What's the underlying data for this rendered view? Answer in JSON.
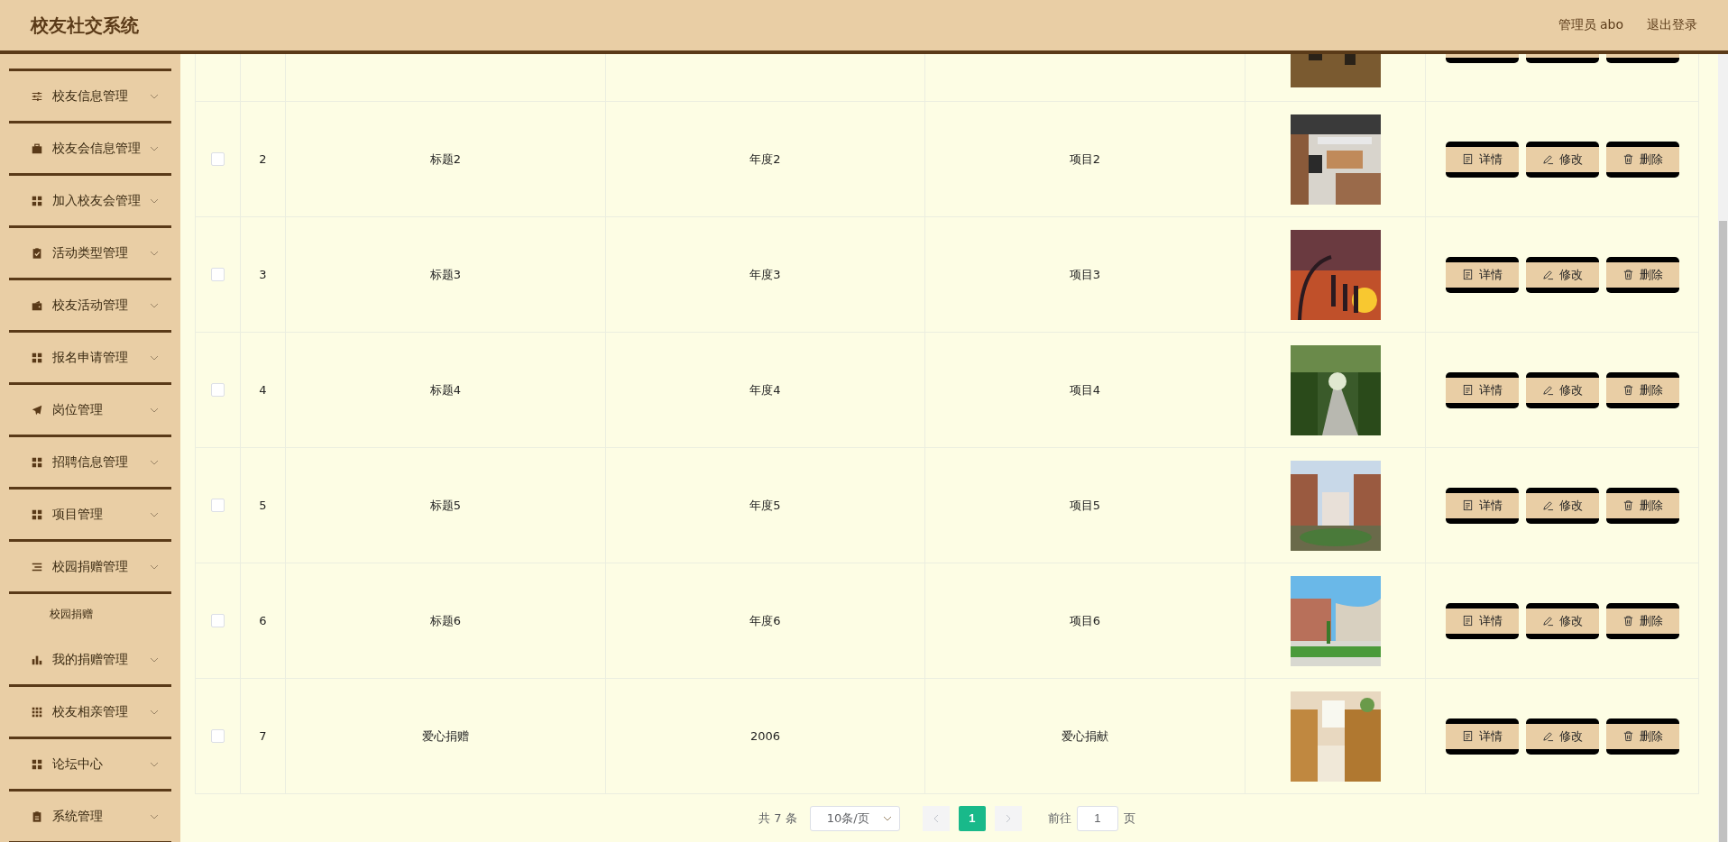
{
  "header": {
    "title": "校友社交系统",
    "user": "管理员 abo",
    "logout": "退出登录"
  },
  "sidebar": {
    "items": [
      {
        "label": "校友信息管理"
      },
      {
        "label": "校友会信息管理"
      },
      {
        "label": "加入校友会管理"
      },
      {
        "label": "活动类型管理"
      },
      {
        "label": "校友活动管理"
      },
      {
        "label": "报名申请管理"
      },
      {
        "label": "岗位管理"
      },
      {
        "label": "招聘信息管理"
      },
      {
        "label": "项目管理"
      },
      {
        "label": "校园捐赠管理",
        "children": [
          {
            "label": "校园捐赠"
          }
        ]
      },
      {
        "label": "我的捐赠管理"
      },
      {
        "label": "校友相亲管理"
      },
      {
        "label": "论坛中心"
      },
      {
        "label": "系统管理"
      }
    ]
  },
  "table": {
    "rows": [
      {
        "kind": "cut",
        "actions": [
          {
            "kind": "detail"
          },
          {
            "kind": "edit"
          },
          {
            "kind": "delete"
          }
        ]
      },
      {
        "kind": "full",
        "checked": false,
        "index": "2",
        "title": "标题2",
        "year": "年度2",
        "project": "项目2",
        "actions": [
          {
            "kind": "detail",
            "label": "详情"
          },
          {
            "kind": "edit",
            "label": "修改"
          },
          {
            "kind": "delete",
            "label": "删除"
          }
        ]
      },
      {
        "kind": "full",
        "checked": false,
        "index": "3",
        "title": "标题3",
        "year": "年度3",
        "project": "项目3",
        "actions": [
          {
            "kind": "detail",
            "label": "详情"
          },
          {
            "kind": "edit",
            "label": "修改"
          },
          {
            "kind": "delete",
            "label": "删除"
          }
        ]
      },
      {
        "kind": "full",
        "checked": false,
        "index": "4",
        "title": "标题4",
        "year": "年度4",
        "project": "项目4",
        "actions": [
          {
            "kind": "detail",
            "label": "详情"
          },
          {
            "kind": "edit",
            "label": "修改"
          },
          {
            "kind": "delete",
            "label": "删除"
          }
        ]
      },
      {
        "kind": "full",
        "checked": false,
        "index": "5",
        "title": "标题5",
        "year": "年度5",
        "project": "项目5",
        "actions": [
          {
            "kind": "detail",
            "label": "详情"
          },
          {
            "kind": "edit",
            "label": "修改"
          },
          {
            "kind": "delete",
            "label": "删除"
          }
        ]
      },
      {
        "kind": "full",
        "checked": false,
        "index": "6",
        "title": "标题6",
        "year": "年度6",
        "project": "项目6",
        "actions": [
          {
            "kind": "detail",
            "label": "详情"
          },
          {
            "kind": "edit",
            "label": "修改"
          },
          {
            "kind": "delete",
            "label": "删除"
          }
        ]
      },
      {
        "kind": "full",
        "checked": false,
        "index": "7",
        "title": "爱心捐赠",
        "year": "2006",
        "project": "爱心捐献",
        "actions": [
          {
            "kind": "detail",
            "label": "详情"
          },
          {
            "kind": "edit",
            "label": "修改"
          },
          {
            "kind": "delete",
            "label": "删除"
          }
        ]
      }
    ]
  },
  "pagination": {
    "total": "共 7 条",
    "page_size": "10条/页",
    "pages": [
      {
        "label": "1",
        "selected": true
      }
    ],
    "goto_label": "前往",
    "goto_value": "1",
    "goto_suffix": "页"
  }
}
